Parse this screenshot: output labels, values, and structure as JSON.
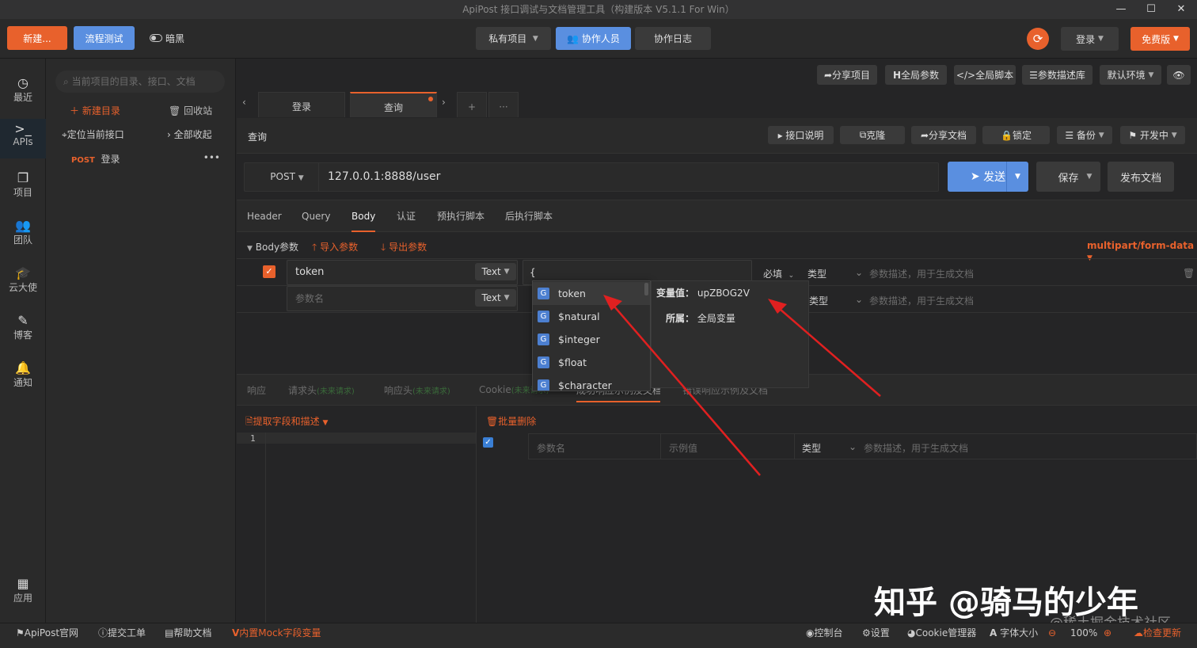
{
  "window": {
    "title": "ApiPost 接口调试与文档管理工具（构建版本 V5.1.1 For Win）"
  },
  "topbar": {
    "new_label": "新建...",
    "flow_label": "流程测试",
    "dark_label": "暗黑",
    "private_project": "私有项目",
    "collaborators": "协作人员",
    "collab_log": "协作日志",
    "login": "登录",
    "free": "免费版"
  },
  "sidebar": {
    "items": [
      "最近",
      "APIs",
      "项目",
      "团队",
      "云大使",
      "博客",
      "通知"
    ],
    "apps": "应用"
  },
  "tree": {
    "search_placeholder": "当前项目的目录、接口、文档",
    "new_dir": "新建目录",
    "recycle": "回收站",
    "locate": "定位当前接口",
    "collapse_all": "全部收起",
    "item_method": "POST",
    "item_name": "登录"
  },
  "toolbar": {
    "share_project": "分享项目",
    "global_params": "全局参数",
    "global_script": "全局脚本",
    "param_lib": "参数描述库",
    "default_env": "默认环境"
  },
  "tabs": [
    {
      "label": "登录"
    },
    {
      "label": "查询"
    }
  ],
  "request": {
    "name": "查询",
    "api_doc": "接口说明",
    "clone": "克隆",
    "share_doc": "分享文档",
    "lock": "锁定",
    "backup": "备份",
    "developing": "开发中",
    "method": "POST",
    "url": "127.0.0.1:8888/user",
    "send": "发送",
    "save": "保存",
    "publish": "发布文档"
  },
  "subtabs": [
    "Header",
    "Query",
    "Body",
    "认证",
    "预执行脚本",
    "后执行脚本"
  ],
  "body": {
    "params_label": "Body参数",
    "import": "导入参数",
    "export": "导出参数",
    "content_type": "multipart/form-data",
    "row1_key": "token",
    "row1_type": "Text",
    "row1_value": "{",
    "required": "必填",
    "type_label": "类型",
    "desc_placeholder": "参数描述，用于生成文档",
    "row2_key_placeholder": "参数名",
    "row2_type": "Text"
  },
  "autocomplete": {
    "items": [
      "token",
      "$natural",
      "$integer",
      "$float",
      "$character"
    ],
    "var_label": "变量值：",
    "var_value": "upZBOG2V",
    "scope_label": "所属：",
    "scope_value": "全局变量"
  },
  "response": {
    "tabs": [
      "响应",
      "请求头",
      "响应头",
      "Cookie",
      "成功响应示例及文档",
      "错误响应示例及文档"
    ],
    "badge1": "(未来请求)",
    "badge2": "(未来请求)",
    "badge3": "(未来请求)",
    "extract": "提取字段和描述",
    "batch_delete": "批量删除",
    "line_no": "1",
    "col_name": "参数名",
    "col_example": "示例值",
    "col_type": "类型",
    "col_desc": "参数描述，用于生成文档"
  },
  "status": {
    "official": "ApiPost官网",
    "ticket": "提交工单",
    "help": "帮助文档",
    "mock": "内置Mock字段变量",
    "console": "控制台",
    "settings": "设置",
    "cookie_mgr": "Cookie管理器",
    "font_size": "字体大小",
    "zoom": "100%",
    "update": "检查更新"
  },
  "watermark": {
    "zhihu": "知乎 @骑马的少年",
    "juejin": "@稀土掘金技术社区"
  }
}
